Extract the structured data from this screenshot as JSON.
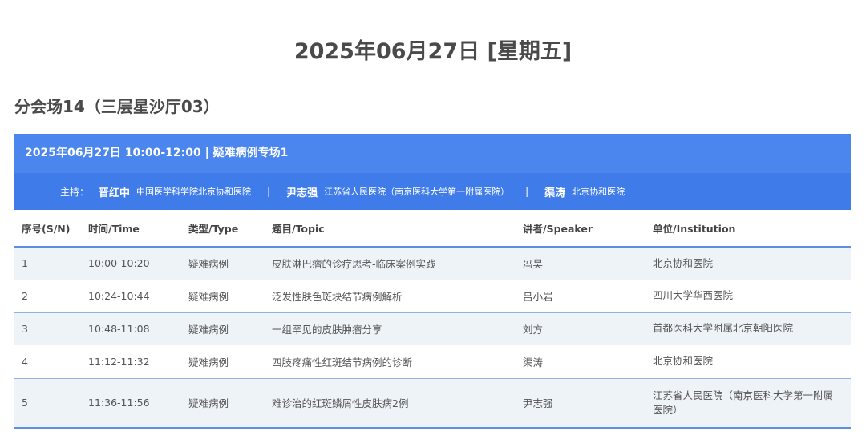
{
  "date_title": "2025年06月27日 [星期五]",
  "venue_title": "分会场14（三层星沙厅03）",
  "session": {
    "header": "2025年06月27日 10:00-12:00 | 疑难病例专场1",
    "hosts_label": "主持：",
    "hosts": [
      {
        "name": "晋红中",
        "institution": "中国医学科学院北京协和医院"
      },
      {
        "name": "尹志强",
        "institution": "江苏省人民医院（南京医科大学第一附属医院）"
      },
      {
        "name": "渠涛",
        "institution": "北京协和医院"
      }
    ],
    "separator": "|"
  },
  "table": {
    "headers": [
      "序号(S/N)",
      "时间/Time",
      "类型/Type",
      "题目/Topic",
      "讲者/Speaker",
      "单位/Institution"
    ],
    "rows": [
      [
        "1",
        "10:00-10:20",
        "疑难病例",
        "皮肤淋巴瘤的诊疗思考-临床案例实践",
        "冯昊",
        "北京协和医院"
      ],
      [
        "2",
        "10:24-10:44",
        "疑难病例",
        "泛发性肤色斑块结节病例解析",
        "吕小岩",
        "四川大学华西医院"
      ],
      [
        "3",
        "10:48-11:08",
        "疑难病例",
        "一组罕见的皮肤肿瘤分享",
        "刘方",
        "首都医科大学附属北京朝阳医院"
      ],
      [
        "4",
        "11:12-11:32",
        "疑难病例",
        "四肢疼痛性红斑结节病例的诊断",
        "渠涛",
        "北京协和医院"
      ],
      [
        "5",
        "11:36-11:56",
        "疑难病例",
        "难诊治的红斑鳞屑性皮肤病2例",
        "尹志强",
        "江苏省人民医院（南京医科大学第一附属医院）"
      ]
    ]
  }
}
